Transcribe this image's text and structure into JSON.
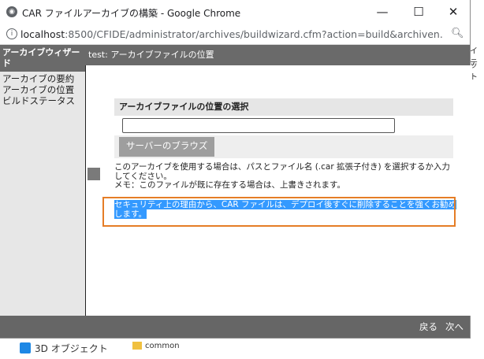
{
  "window": {
    "title": "CAR ファイルアーカイブの構築 - Google Chrome",
    "minimize": "—",
    "maximize": "☐",
    "close": "✕"
  },
  "address": {
    "host": "localhost",
    "rest": ":8500/CFIDE/administrator/archives/buildwizard.cfm?action=build&archiven..."
  },
  "sidebar": {
    "heading": "アーカイブウィザード",
    "items": [
      "アーカイブの要約",
      "アーカイブの位置",
      "ビルドステータス"
    ]
  },
  "dialog": {
    "header": "test: アーカイブファイルの位置",
    "section_label": "アーカイブファイルの位置の選択",
    "path_value": "",
    "browse_button": "サーバーのブラウズ",
    "note1": "このアーカイブを使用する場合は、パスとファイル名 (.car 拡張子付き) を選択するか入力してください。",
    "note2": "メモ：このファイルが既に存在する場合は、上書きされます。",
    "note3": "セキュリティ上の理由から、CAR ファイルは、デプロイ後すぐに削除することを強くお勧めします。"
  },
  "footer": {
    "back": "戻る",
    "next": "次へ"
  },
  "background": {
    "right_text_1": "イテ",
    "right_text_2": "ット",
    "bottom_item": "3D オブジェクト",
    "bottom_item_2": "common"
  },
  "colors": {
    "header_gray": "#6a6a6a",
    "highlight_blue": "#3399ff",
    "callout_orange": "#e57d26"
  }
}
